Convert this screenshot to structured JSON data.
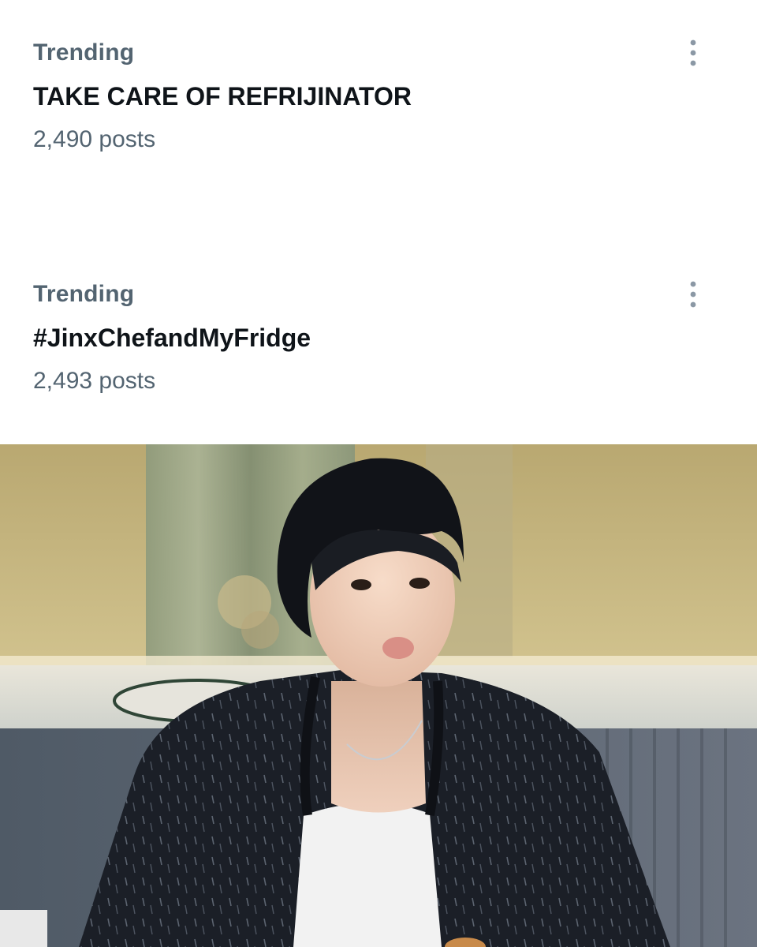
{
  "trends": [
    {
      "label": "Trending",
      "title": "TAKE CARE OF REFRIJINATOR",
      "count": "2,490 posts",
      "menu_icon": "more-vertical-icon"
    },
    {
      "label": "Trending",
      "title": "#JinxChefandMyFridge",
      "count": "2,493 posts",
      "menu_icon": "more-vertical-icon"
    }
  ],
  "photo": {
    "subject": "person-photo"
  },
  "colors": {
    "secondary_text": "#536471",
    "primary_text": "#0f1419",
    "icon": "#8b98a5"
  }
}
